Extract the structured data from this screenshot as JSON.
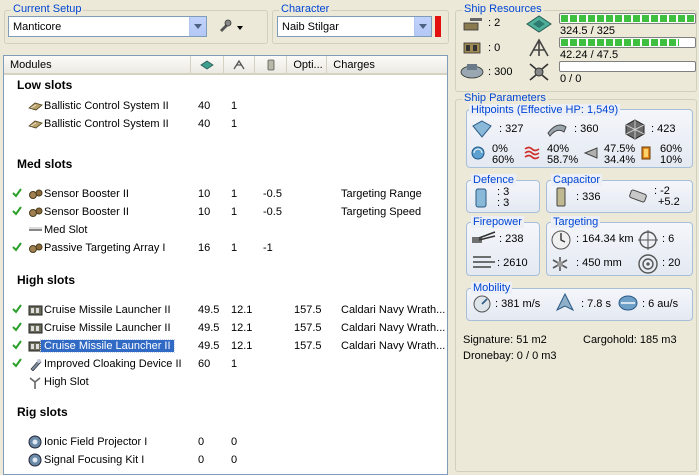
{
  "setup": {
    "label": "Current Setup",
    "value": "Manticore"
  },
  "character": {
    "label": "Character",
    "value": "Naib Stilgar",
    "color_swatch": "#e31010"
  },
  "modules": {
    "columns": [
      "Modules",
      "",
      "",
      "",
      "Opti...",
      "Charges"
    ],
    "sections": {
      "low": "Low slots",
      "med": "Med slots",
      "high": "High slots",
      "rig": "Rig slots"
    },
    "low": [
      {
        "name": "Ballistic Control System II",
        "cpu": "40",
        "pg": "1",
        "cap": "",
        "opt": "",
        "charge": "",
        "active": false
      },
      {
        "name": "Ballistic Control System II",
        "cpu": "40",
        "pg": "1",
        "cap": "",
        "opt": "",
        "charge": "",
        "active": false
      }
    ],
    "med": [
      {
        "name": "Sensor Booster II",
        "cpu": "10",
        "pg": "1",
        "cap": "-0.5",
        "opt": "",
        "charge": "Targeting Range",
        "active": true
      },
      {
        "name": "Sensor Booster II",
        "cpu": "10",
        "pg": "1",
        "cap": "-0.5",
        "opt": "",
        "charge": "Targeting Speed",
        "active": true
      },
      {
        "name": "Med Slot",
        "cpu": "",
        "pg": "",
        "cap": "",
        "opt": "",
        "charge": "",
        "active": false
      },
      {
        "name": "Passive Targeting Array I",
        "cpu": "16",
        "pg": "1",
        "cap": "-1",
        "opt": "",
        "charge": "",
        "active": true
      }
    ],
    "high": [
      {
        "name": "Cruise Missile Launcher II",
        "cpu": "49.5",
        "pg": "12.1",
        "cap": "",
        "opt": "157.5",
        "charge": "Caldari Navy Wrath...",
        "active": true
      },
      {
        "name": "Cruise Missile Launcher II",
        "cpu": "49.5",
        "pg": "12.1",
        "cap": "",
        "opt": "157.5",
        "charge": "Caldari Navy Wrath...",
        "active": true
      },
      {
        "name": "Cruise Missile Launcher II",
        "cpu": "49.5",
        "pg": "12.1",
        "cap": "",
        "opt": "157.5",
        "charge": "Caldari Navy Wrath...",
        "active": true
      },
      {
        "name": "Improved Cloaking Device II",
        "cpu": "60",
        "pg": "1",
        "cap": "",
        "opt": "",
        "charge": "",
        "active": true
      },
      {
        "name": "High Slot",
        "cpu": "",
        "pg": "",
        "cap": "",
        "opt": "",
        "charge": "",
        "active": false
      }
    ],
    "rig": [
      {
        "name": "Ionic Field Projector I",
        "cpu": "0",
        "pg": "0",
        "cap": "",
        "opt": "",
        "charge": "",
        "active": false
      },
      {
        "name": "Signal Focusing Kit I",
        "cpu": "0",
        "pg": "0",
        "cap": "",
        "opt": "",
        "charge": "",
        "active": false
      }
    ]
  },
  "resources": {
    "label": "Ship Resources",
    "turrets": ": 2",
    "launchers": ": 0",
    "calibration": ": 300",
    "cpu": "324.5 / 325",
    "cpu_fraction": 0.998,
    "powergrid": "42.24 / 47.5",
    "powergrid_fraction": 0.889,
    "drone_bandwidth": "0 / 0",
    "drone_fraction": 0
  },
  "params": {
    "label": "Ship Parameters",
    "hitpoints_label": "Hitpoints (Effective HP: 1,549)",
    "shield_hp": ": 327",
    "armor_hp": ": 360",
    "structure_hp": ": 423",
    "res_em": "0%\n60%",
    "res_em_top": "0%",
    "res_em_bot": "60%",
    "res_th_top": "40%",
    "res_th_bot": "58.7%",
    "res_ki_top": "47.5%",
    "res_ki_bot": "34.4%",
    "res_ex_top": "60%",
    "res_ex_bot": "10%",
    "defence_label": "Defence",
    "defence_top": ": 3",
    "defence_bot": ": 3",
    "capacitor_label": "Capacitor",
    "cap_amount": ": 336",
    "cap_top": ": -2",
    "cap_bot": "+5.2",
    "firepower_label": "Firepower",
    "fp_dps": ": 238",
    "fp_volley": ": 2610",
    "targeting_label": "Targeting",
    "target_range": ": 164.34 km",
    "max_targets": ": 6",
    "scan_res": ": 450 mm",
    "sensor_strength": ": 20",
    "mobility_label": "Mobility",
    "velocity": ": 381 m/s",
    "align_time": ": 7.8 s",
    "warp_speed": ": 6 au/s",
    "signature": "Signature: 51 m2",
    "cargohold": "Cargohold: 185 m3",
    "dronebay": "Dronebay: 0 / 0 m3"
  }
}
